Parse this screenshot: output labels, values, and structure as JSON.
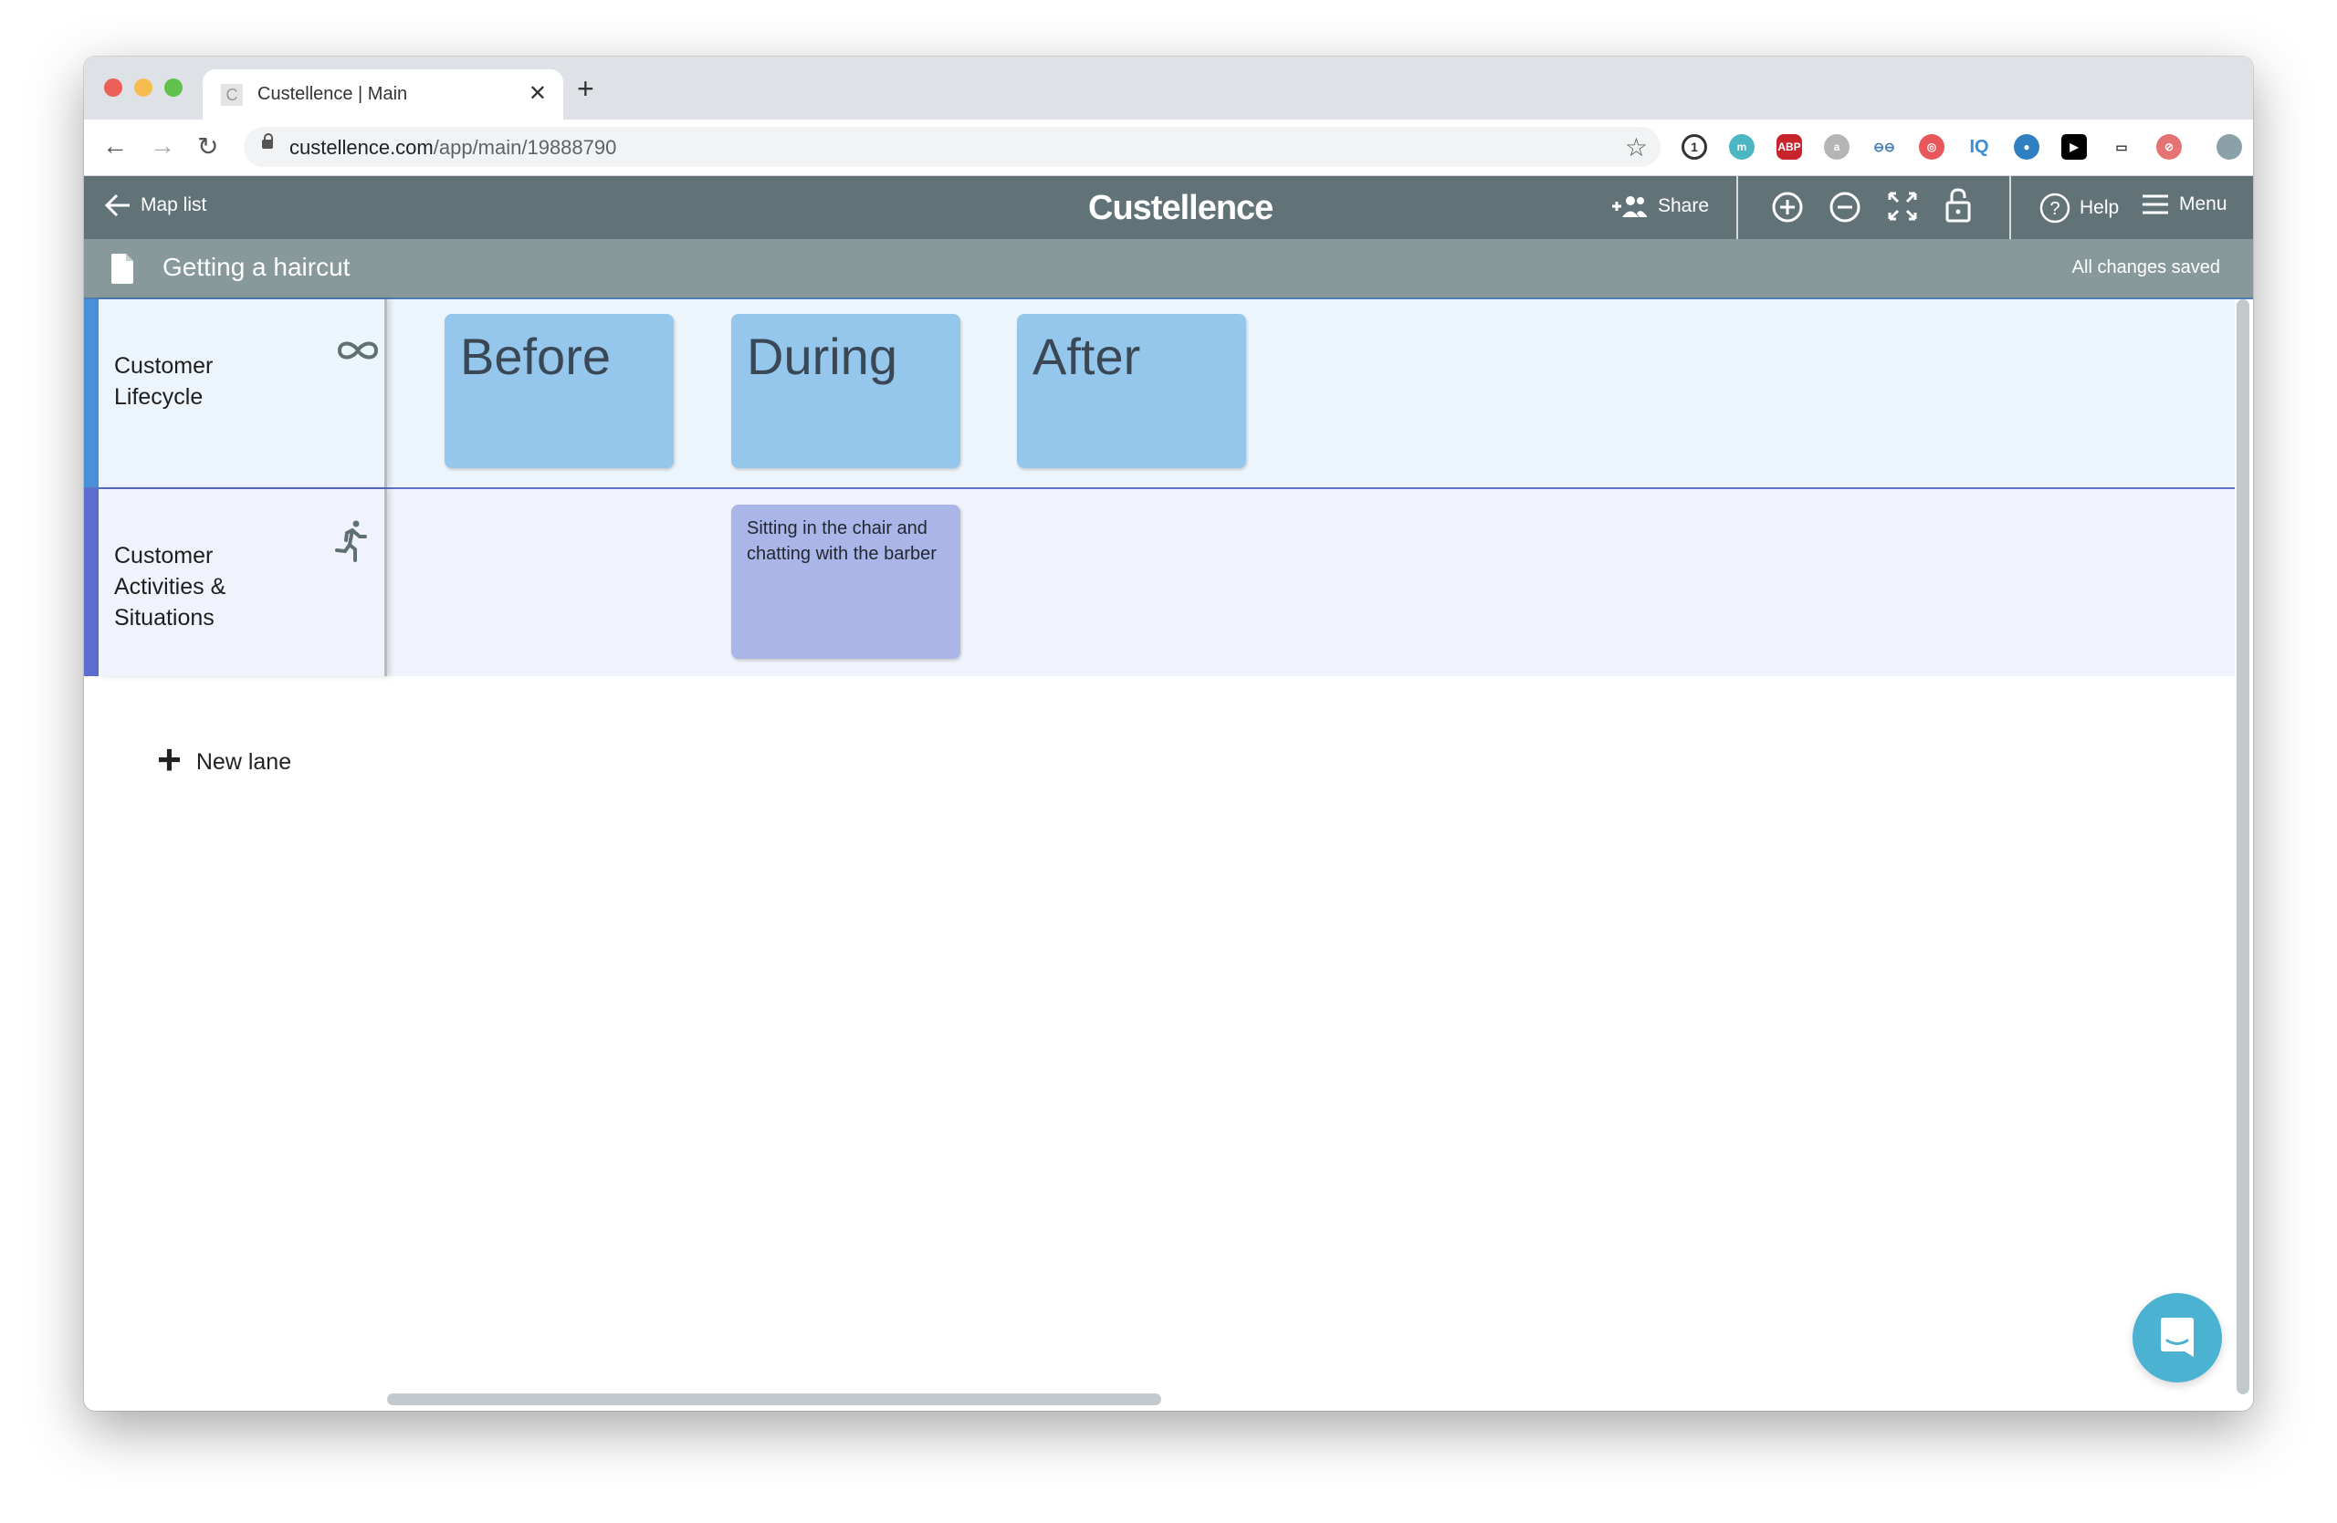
{
  "browser": {
    "tab_title": "Custellence | Main",
    "tab_favicon_letter": "C",
    "url_domain": "custellence.com",
    "url_path": "/app/main/19888790",
    "extensions": [
      {
        "name": "1password-icon",
        "label": "1",
        "color": "#333333"
      },
      {
        "name": "m-extension-icon",
        "label": "m",
        "color": "#4cb6c2"
      },
      {
        "name": "adblock-plus-icon",
        "label": "ABP",
        "color": "#c8242b"
      },
      {
        "name": "comment-extension-icon",
        "label": "a",
        "color": "#b5b5b5"
      },
      {
        "name": "link-extension-icon",
        "label": "⊖⊖",
        "color": "#3d7bb7"
      },
      {
        "name": "spiral-extension-icon",
        "label": "◎",
        "color": "#e8585b"
      },
      {
        "name": "iq-extension-icon",
        "label": "IQ",
        "color": "#3c8dd6"
      },
      {
        "name": "eye-extension-icon",
        "label": "●",
        "color": "#2f7fc1"
      },
      {
        "name": "play-extension-icon",
        "label": "▶",
        "color": "#000000"
      },
      {
        "name": "screenshot-extension-icon",
        "label": "▭",
        "color": "#333333"
      },
      {
        "name": "shield-extension-icon",
        "label": "⊘",
        "color": "#e57373"
      },
      {
        "name": "profile-avatar-icon",
        "label": "",
        "color": "#8aa1a8"
      },
      {
        "name": "update-extension-icon",
        "label": "⬆",
        "color": "#d93025"
      }
    ]
  },
  "app": {
    "back_label": "Map list",
    "logo": "Custellence",
    "share_label": "Share",
    "help_label": "Help",
    "menu_label": "Menu",
    "map_name": "Getting a haircut",
    "save_status": "All changes saved"
  },
  "lanes": [
    {
      "title": "Customer Lifecycle",
      "icon": "infinity-icon",
      "color": "#4a90d9",
      "cards": [
        {
          "text": "Before",
          "column": 0
        },
        {
          "text": "During",
          "column": 1
        },
        {
          "text": "After",
          "column": 2
        }
      ]
    },
    {
      "title": "Customer Activities & Situations",
      "icon": "running-person-icon",
      "color": "#5c6ccf",
      "cards": [
        {
          "text": "Sitting in the chair and chatting with the barber",
          "column": 1
        }
      ]
    }
  ],
  "new_lane_label": "New lane"
}
